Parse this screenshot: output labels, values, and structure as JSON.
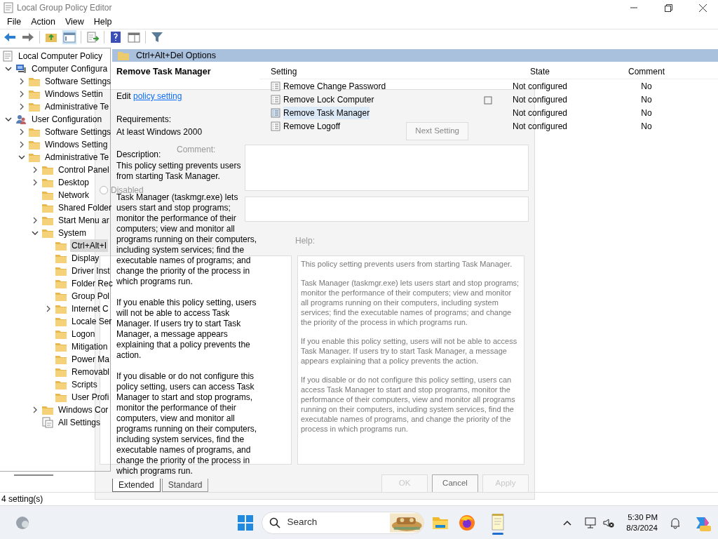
{
  "window": {
    "title": "Local Group Policy Editor"
  },
  "menu": [
    "File",
    "Action",
    "View",
    "Help"
  ],
  "tree": {
    "root": {
      "label": "Local Computer Policy"
    },
    "items": [
      {
        "label": "Computer Configura",
        "kind": "computer",
        "expanded": true,
        "selected": false,
        "children": [
          {
            "label": "Software Settings",
            "kind": "folder",
            "expanded": false,
            "selected": false
          },
          {
            "label": "Windows Settin",
            "kind": "folder",
            "expanded": false,
            "selected": false
          },
          {
            "label": "Administrative Te",
            "kind": "folder",
            "expanded": false,
            "selected": false
          }
        ]
      },
      {
        "label": "User Configuration",
        "kind": "user",
        "expanded": true,
        "selected": false,
        "children": [
          {
            "label": "Software Settings",
            "kind": "folder",
            "expanded": false,
            "selected": false
          },
          {
            "label": "Windows Setting",
            "kind": "folder",
            "expanded": false,
            "selected": false
          },
          {
            "label": "Administrative Te",
            "kind": "folder",
            "expanded": true,
            "selected": false,
            "children": [
              {
                "label": "Control Panel",
                "kind": "folder",
                "expanded": false,
                "selected": false
              },
              {
                "label": "Desktop",
                "kind": "folder",
                "expanded": false,
                "selected": false
              },
              {
                "label": "Network",
                "kind": "folder",
                "selected": false
              },
              {
                "label": "Shared Folder",
                "kind": "folder",
                "selected": false
              },
              {
                "label": "Start Menu ar",
                "kind": "folder",
                "expanded": false,
                "selected": false
              },
              {
                "label": "System",
                "kind": "folder",
                "expanded": true,
                "selected": false,
                "children": [
                  {
                    "label": "Ctrl+Alt+I",
                    "kind": "folder",
                    "selected": true
                  },
                  {
                    "label": "Display",
                    "kind": "folder",
                    "selected": false
                  },
                  {
                    "label": "Driver Inst",
                    "kind": "folder",
                    "selected": false
                  },
                  {
                    "label": "Folder Rec",
                    "kind": "folder",
                    "selected": false
                  },
                  {
                    "label": "Group Pol",
                    "kind": "folder",
                    "selected": false
                  },
                  {
                    "label": "Internet C",
                    "kind": "folder",
                    "expanded": false,
                    "selected": false
                  },
                  {
                    "label": "Locale Ser",
                    "kind": "folder",
                    "selected": false
                  },
                  {
                    "label": "Logon",
                    "kind": "folder",
                    "selected": false
                  },
                  {
                    "label": "Mitigation",
                    "kind": "folder",
                    "selected": false
                  },
                  {
                    "label": "Power Ma",
                    "kind": "folder",
                    "selected": false
                  },
                  {
                    "label": "Removabl",
                    "kind": "folder",
                    "selected": false
                  },
                  {
                    "label": "Scripts",
                    "kind": "folder",
                    "selected": false
                  },
                  {
                    "label": "User Profi",
                    "kind": "folder",
                    "selected": false
                  }
                ]
              },
              {
                "label": "Windows Cor",
                "kind": "folder",
                "expanded": false,
                "selected": false
              },
              {
                "label": "All Settings",
                "kind": "settings",
                "selected": false
              }
            ]
          }
        ]
      }
    ]
  },
  "pane": {
    "header": "Ctrl+Alt+Del Options",
    "extended": {
      "title": "Remove Task Manager",
      "edit_prefix": "Edit",
      "edit_link": "policy setting",
      "requirements_label": "Requirements:",
      "requirements": "At least Windows 2000",
      "description_label": "Description:",
      "description": [
        "This policy setting prevents users from starting Task Manager.",
        "Task Manager (taskmgr.exe) lets users start and stop programs; monitor the performance of their computers; view and monitor all programs running on their computers, including system services; find the executable names of programs; and change the priority of the process in which programs run.",
        "If you enable this policy setting, users will not be able to access Task Manager. If users try to start Task Manager, a message appears explaining that a policy prevents the action.",
        "If you disable or do not configure this policy setting, users can access Task Manager to  start and stop programs, monitor the performance of their computers, view and monitor all programs running on their computers, including system services, find the executable names of programs, and change the priority of the process in which programs run."
      ]
    },
    "table": {
      "columns": [
        "Setting",
        "State",
        "Comment"
      ],
      "rows": [
        {
          "setting": "Remove Change Password",
          "state": "Not configured",
          "comment": "No",
          "selected": false
        },
        {
          "setting": "Remove Lock Computer",
          "state": "Not configured",
          "comment": "No",
          "selected": false
        },
        {
          "setting": "Remove Task Manager",
          "state": "Not configured",
          "comment": "No",
          "selected": true
        },
        {
          "setting": "Remove Logoff",
          "state": "Not configured",
          "comment": "No",
          "selected": false
        }
      ]
    },
    "tabs": [
      {
        "label": "Extended",
        "selected": true
      },
      {
        "label": "Standard",
        "selected": false
      }
    ]
  },
  "status_bar": "4 setting(s)",
  "dialog": {
    "nav_button": "Next Setting",
    "radios": [
      {
        "label": "Disabled",
        "selected": false
      }
    ],
    "comment_label": "Comment:",
    "help_label": "Help:",
    "help": [
      "This policy setting prevents users from starting Task Manager.",
      "Task Manager (taskmgr.exe) lets users start and stop programs; monitor the performance of their computers; view and monitor all programs running on their computers, including system services; find the executable names of programs; and change the priority of the process in which programs run.",
      "If you enable this policy setting, users will not be able to access Task Manager. If users try to start Task Manager, a message appears explaining that a policy prevents the action.",
      "If you disable or do not configure this policy setting, users can access Task Manager to  start and stop programs, monitor the performance of their computers, view and monitor all programs running on their computers, including system services, find the executable names of programs, and change the priority of the process in which programs run."
    ],
    "buttons": [
      {
        "label": "OK",
        "disabled": true
      },
      {
        "label": "Cancel",
        "disabled": false
      },
      {
        "label": "Apply",
        "disabled": true
      }
    ]
  },
  "taskbar": {
    "search": {
      "placeholder": "Search"
    },
    "time": "5:30 PM",
    "date": "8/3/2024"
  }
}
